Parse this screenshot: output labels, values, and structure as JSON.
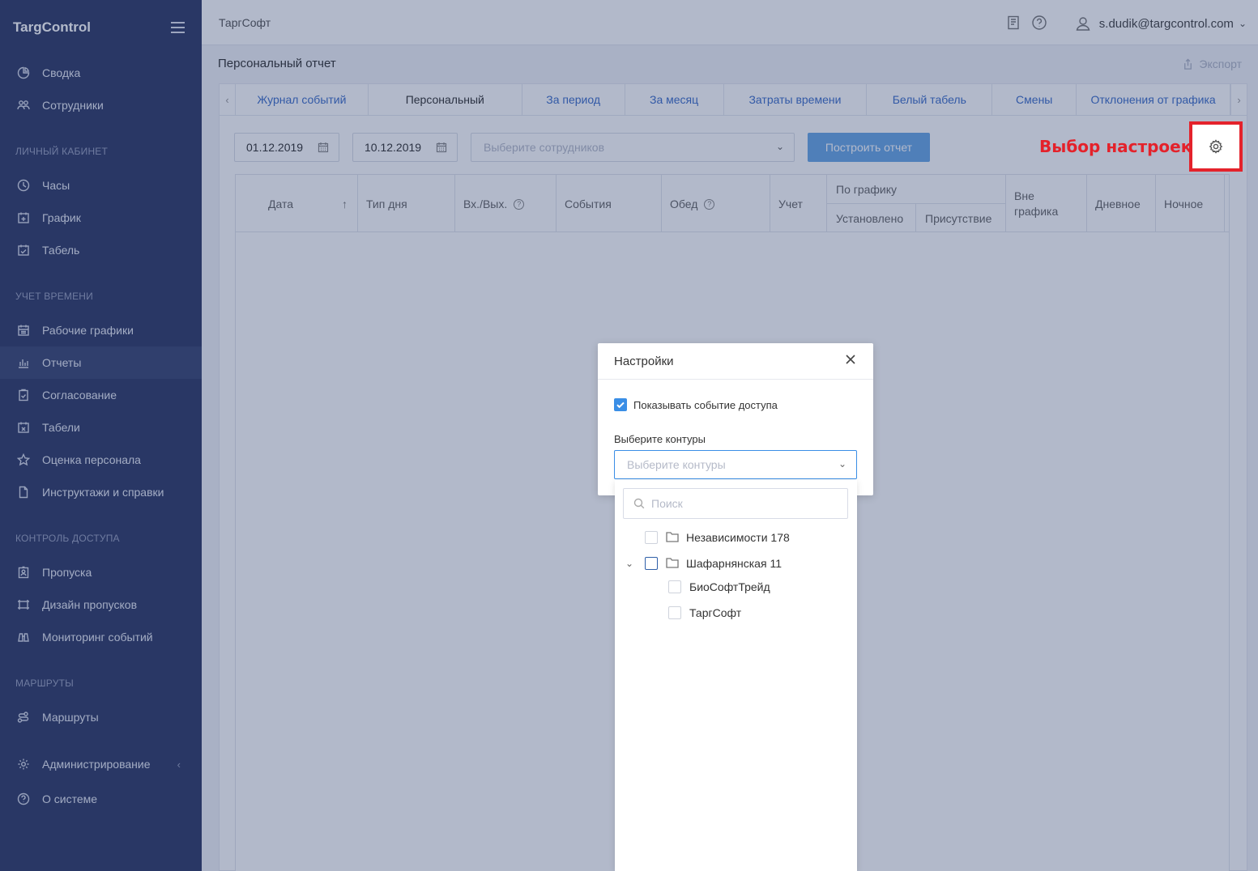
{
  "brand": "TargControl",
  "sidebar": {
    "items_top": [
      {
        "label": "Сводка",
        "icon": "pie-chart-icon"
      },
      {
        "label": "Сотрудники",
        "icon": "users-icon"
      }
    ],
    "sections": {
      "personal": "ЛИЧНЫЙ КАБИНЕТ",
      "time": "УЧЕТ ВРЕМЕНИ",
      "access": "КОНТРОЛЬ ДОСТУПА",
      "routes": "МАРШРУТЫ"
    },
    "personal_items": [
      {
        "label": "Часы",
        "icon": "clock-icon"
      },
      {
        "label": "График",
        "icon": "calendar-plus-icon"
      },
      {
        "label": "Табель",
        "icon": "calendar-check-icon"
      }
    ],
    "time_items": [
      {
        "label": "Рабочие графики",
        "icon": "calendar-grid-icon"
      },
      {
        "label": "Отчеты",
        "icon": "bar-chart-icon"
      },
      {
        "label": "Согласование",
        "icon": "clipboard-check-icon"
      },
      {
        "label": "Табели",
        "icon": "calendar-x-icon"
      },
      {
        "label": "Оценка персонала",
        "icon": "star-icon"
      },
      {
        "label": "Инструктажи и справки",
        "icon": "document-icon"
      }
    ],
    "access_items": [
      {
        "label": "Пропуска",
        "icon": "badge-icon"
      },
      {
        "label": "Дизайн пропусков",
        "icon": "design-icon"
      },
      {
        "label": "Мониторинг событий",
        "icon": "binoculars-icon"
      }
    ],
    "routes_items": [
      {
        "label": "Маршруты",
        "icon": "route-icon"
      }
    ],
    "bottom_items": [
      {
        "label": "Администрирование",
        "icon": "gear-icon"
      },
      {
        "label": "О системе",
        "icon": "help-icon"
      }
    ]
  },
  "topbar": {
    "org": "ТаргСофт",
    "user": "s.dudik@targcontrol.com"
  },
  "page": {
    "title": "Персональный отчет",
    "export": "Экспорт"
  },
  "tabs": [
    {
      "label": "Журнал событий",
      "active": false
    },
    {
      "label": "Персональный",
      "active": true
    },
    {
      "label": "За период",
      "active": false
    },
    {
      "label": "За месяц",
      "active": false
    },
    {
      "label": "Затраты времени",
      "active": false
    },
    {
      "label": "Белый табель",
      "active": false
    },
    {
      "label": "Смены",
      "active": false
    },
    {
      "label": "Отклонения от графика",
      "active": false
    }
  ],
  "filters": {
    "date_from": "01.12.2019",
    "date_to": "10.12.2019",
    "employees_placeholder": "Выберите сотрудников",
    "build_button": "Построить отчет"
  },
  "annotation": "Выбор настроек",
  "table": {
    "columns": {
      "date": "Дата",
      "day_type": "Тип дня",
      "in_out": "Вх./Вых.",
      "events": "События",
      "lunch": "Обед",
      "accounting": "Учет",
      "by_schedule": "По графику",
      "established": "Установлено",
      "presence": "Присутствие",
      "off_schedule": "Вне графика",
      "day": "Дневное",
      "night": "Ночное"
    }
  },
  "modal": {
    "title": "Настройки",
    "show_access_event": "Показывать событие доступа",
    "contours_label": "Выберите контуры",
    "contours_placeholder": "Выберите контуры",
    "search_placeholder": "Поиск",
    "tree": [
      {
        "label": "Независимости 178",
        "level": 0,
        "folder": true
      },
      {
        "label": "Шафарнянская 11",
        "level": 0,
        "folder": true,
        "expanded": true
      },
      {
        "label": "БиоСофтТрейд",
        "level": 1,
        "folder": false
      },
      {
        "label": "ТаргСофт",
        "level": 1,
        "folder": false
      }
    ]
  },
  "colors": {
    "sidebar_bg": "#2f3a66",
    "accent": "#3a8ee6",
    "link": "#3d6ec9",
    "annotation": "#e4222b"
  }
}
